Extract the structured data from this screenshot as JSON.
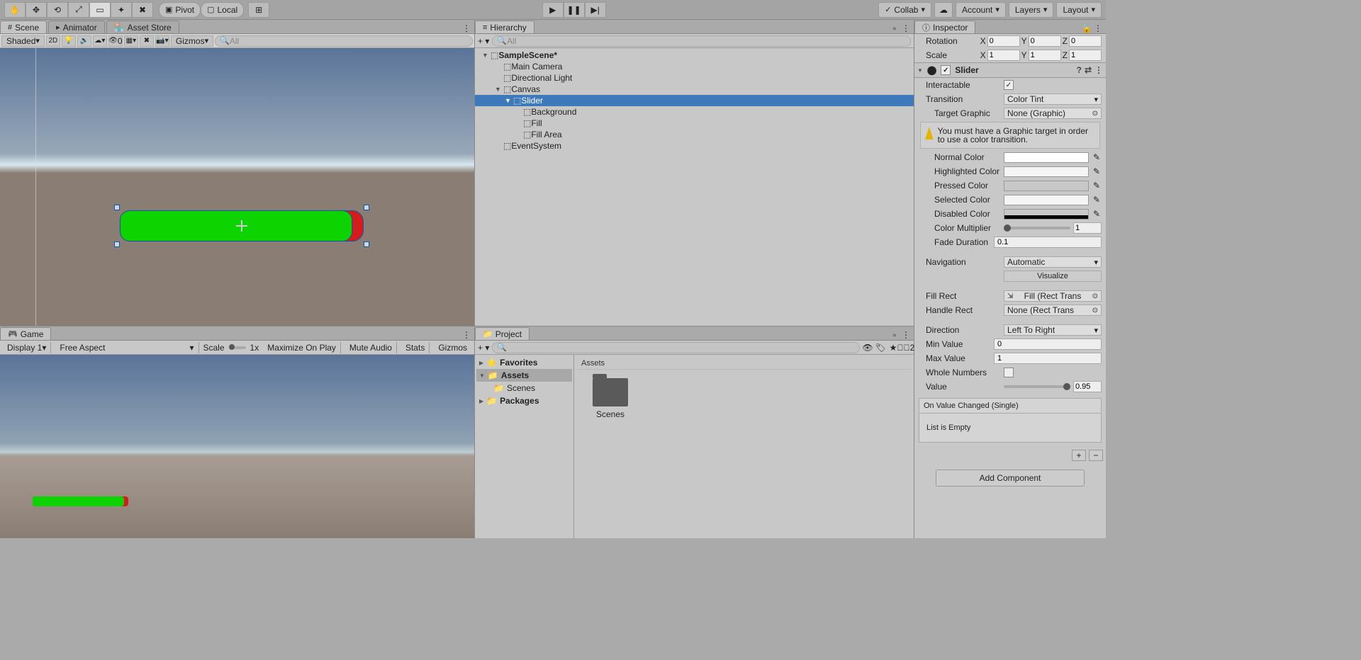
{
  "toolbar": {
    "pivot": "Pivot",
    "local": "Local",
    "collab": "Collab",
    "account": "Account",
    "layers": "Layers",
    "layout": "Layout"
  },
  "tabs": {
    "scene": "Scene",
    "animator": "Animator",
    "assetstore": "Asset Store",
    "game": "Game",
    "hierarchy": "Hierarchy",
    "project": "Project",
    "inspector": "Inspector"
  },
  "scene": {
    "shading": "Shaded",
    "twod": "2D",
    "gizmos": "Gizmos",
    "search": "All",
    "cull": "0"
  },
  "game": {
    "display": "Display 1",
    "aspect": "Free Aspect",
    "scale": "Scale",
    "scaleval": "1x",
    "maxonplay": "Maximize On Play",
    "mute": "Mute Audio",
    "stats": "Stats",
    "gizmos": "Gizmos"
  },
  "hierarchy": {
    "search": "All",
    "scene": "SampleScene*",
    "items": [
      "Main Camera",
      "Directional Light",
      "Canvas",
      "Slider",
      "Background",
      "Fill",
      "Fill Area",
      "EventSystem"
    ]
  },
  "project": {
    "search": "",
    "favorites": "Favorites",
    "assets": "Assets",
    "scenes": "Scenes",
    "packages": "Packages",
    "folderlabel": "Scenes",
    "header": "Assets",
    "hidden": "2"
  },
  "inspector": {
    "rotation": "Rotation",
    "scale": "Scale",
    "rot": {
      "x": "0",
      "y": "0",
      "z": "0"
    },
    "scl": {
      "x": "1",
      "y": "1",
      "z": "1"
    },
    "component": "Slider",
    "interactable": "Interactable",
    "transition": "Transition",
    "transitionval": "Color Tint",
    "targetgraphic": "Target Graphic",
    "targetgraphicval": "None (Graphic)",
    "warn": "You must have a Graphic target in order to use a color transition.",
    "normalcolor": "Normal Color",
    "highlightedcolor": "Highlighted Color",
    "pressedcolor": "Pressed Color",
    "selectedcolor": "Selected Color",
    "disabledcolor": "Disabled Color",
    "colormult": "Color Multiplier",
    "colormultval": "1",
    "fadedur": "Fade Duration",
    "fadedurval": "0.1",
    "navigation": "Navigation",
    "navigationval": "Automatic",
    "visualize": "Visualize",
    "fillrect": "Fill Rect",
    "fillrectval": "Fill (Rect Trans",
    "handlerect": "Handle Rect",
    "handlerectval": "None (Rect Trans",
    "direction": "Direction",
    "directionval": "Left To Right",
    "minvalue": "Min Value",
    "minvalueval": "0",
    "maxvalue": "Max Value",
    "maxvalueval": "1",
    "wholenumbers": "Whole Numbers",
    "value": "Value",
    "valueval": "0.95",
    "onvaluechanged": "On Value Changed (Single)",
    "listempty": "List is Empty",
    "addcomponent": "Add Component"
  }
}
